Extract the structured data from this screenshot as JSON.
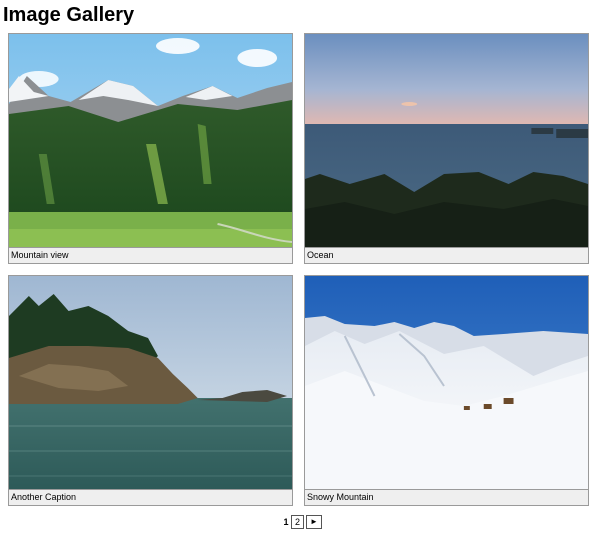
{
  "page": {
    "title": "Image Gallery"
  },
  "gallery": {
    "items": [
      {
        "caption": "Mountain view",
        "image": "alpine-mountain-forest-photo"
      },
      {
        "caption": "Ocean",
        "image": "ocean-sunset-coast-photo"
      },
      {
        "caption": "Another Caption",
        "image": "rocky-island-sea-photo"
      },
      {
        "caption": "Snowy Mountain",
        "image": "snowy-mountain-ski-slope-photo"
      }
    ]
  },
  "pagination": {
    "current": "1",
    "pages": [
      "2"
    ],
    "next_icon": "►"
  }
}
